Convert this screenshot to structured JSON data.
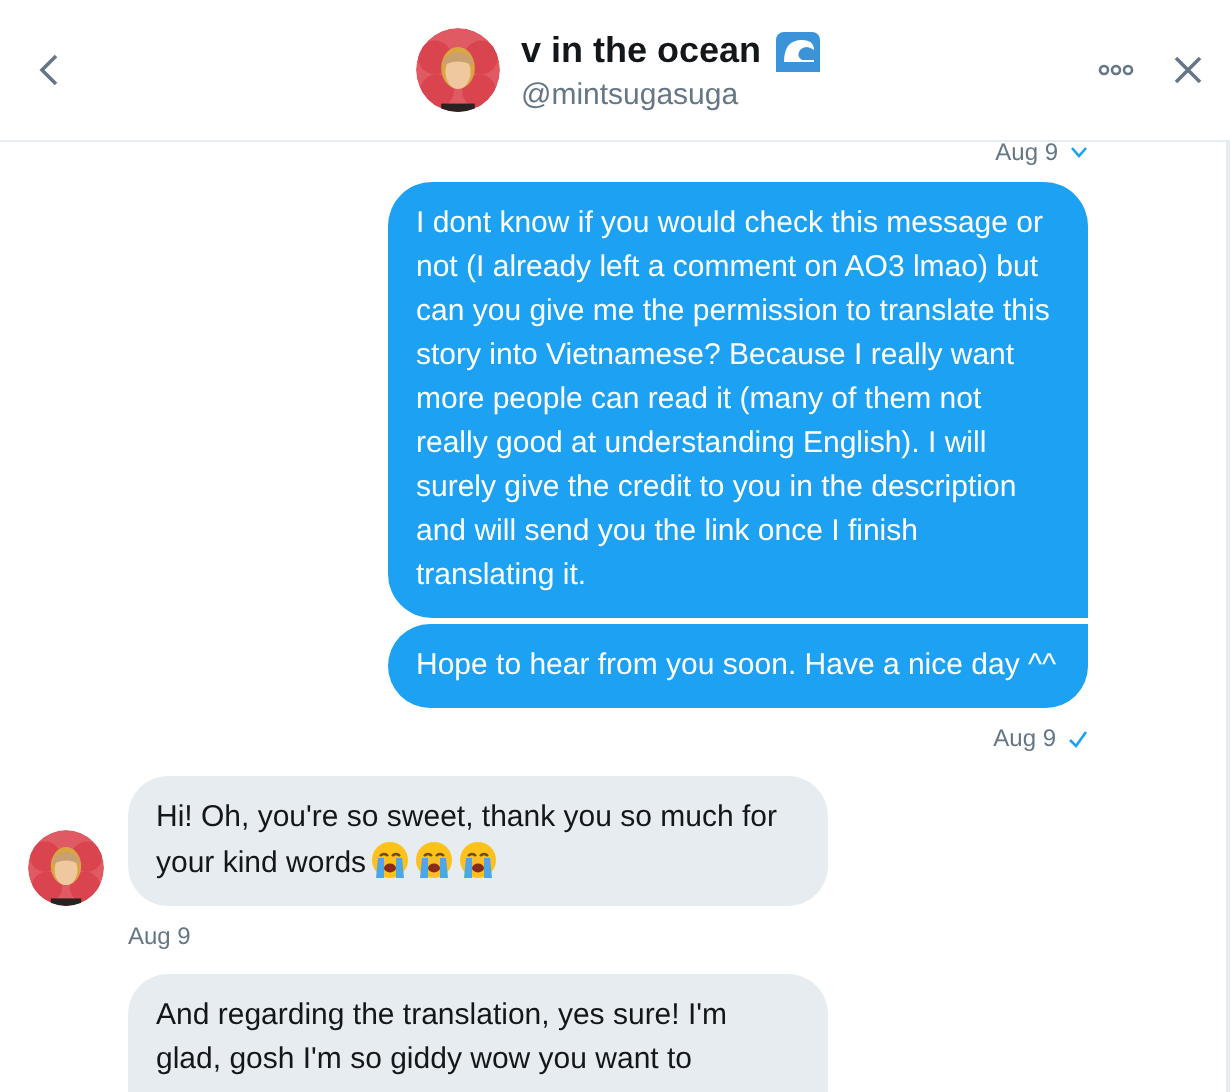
{
  "header": {
    "name": "v in the ocean",
    "handle": "@mintsugasuga"
  },
  "messages": [
    {
      "kind": "sent_time",
      "time": "Aug 9",
      "menu": true
    },
    {
      "kind": "sent_bubble",
      "text": "I dont know if you would check this message or not (I already left a comment on AO3 lmao) but can you give me the permission to translate this story into Vietnamese? Because I really want more people can read it (many of them not really good at understanding English). I will surely give the credit to you in the description and will send you the link once I finish translating it."
    },
    {
      "kind": "sent_bubble",
      "text": "Hope to hear from you soon. Have a nice day ^^"
    },
    {
      "kind": "sent_time",
      "time": "Aug 9",
      "read": true
    },
    {
      "kind": "received_bubble",
      "text": "Hi! Oh, you're so sweet, thank you so much for your kind words",
      "avatar": true
    },
    {
      "kind": "received_time",
      "time": "Aug 9"
    },
    {
      "kind": "received_bubble",
      "text": "And regarding the translation, yes sure! I'm glad, gosh I'm so giddy wow you want to",
      "avatar": false
    }
  ]
}
